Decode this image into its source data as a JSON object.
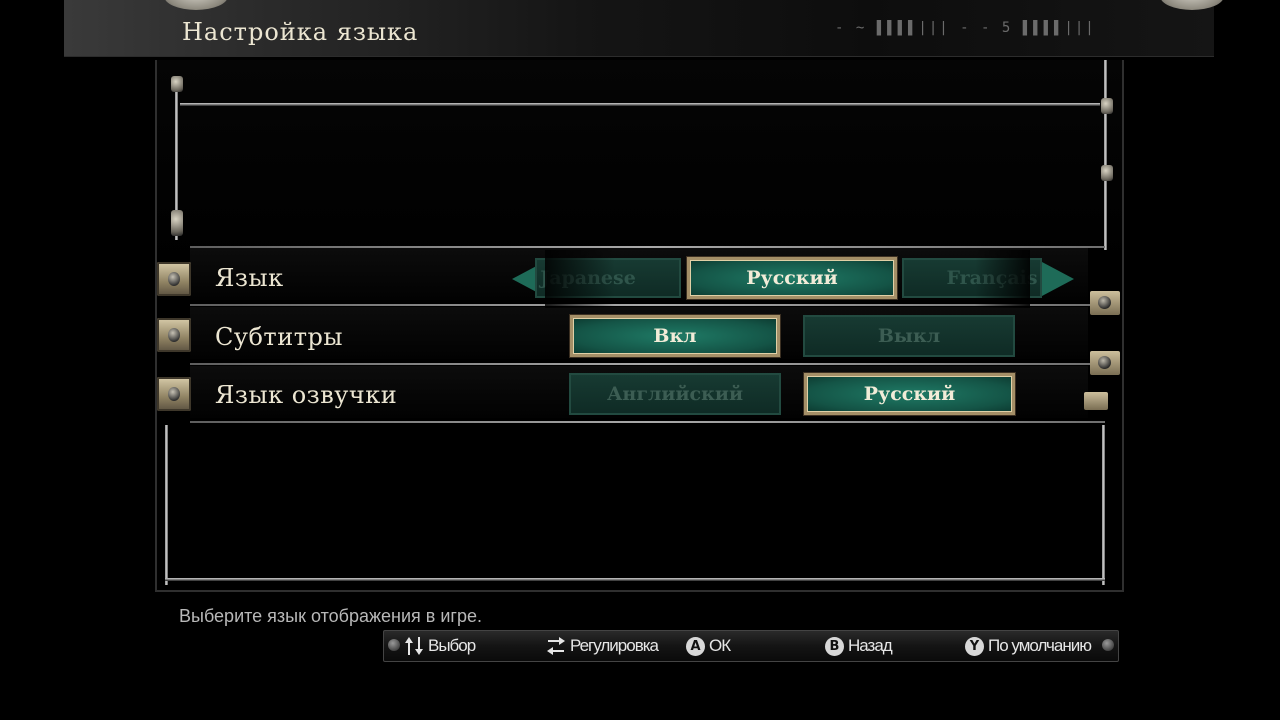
{
  "header": {
    "title": "Настройка языка",
    "glyph_strip": "-  ~  ▌▌▌▌|||  - -  5  ▌▌▌▌|||"
  },
  "rows": [
    {
      "label": "Язык",
      "left_arrow": "arrow-left-icon",
      "right_arrow": "arrow-right-icon",
      "options": [
        {
          "label": "Japanese",
          "selected": false
        },
        {
          "label": "Русский",
          "selected": true
        },
        {
          "label": "Français",
          "selected": false
        }
      ]
    },
    {
      "label": "Субтитры",
      "options": [
        {
          "label": "Вкл",
          "selected": true
        },
        {
          "label": "Выкл",
          "selected": false
        }
      ]
    },
    {
      "label": "Язык озвучки",
      "options": [
        {
          "label": "Английский",
          "selected": false
        },
        {
          "label": "Русский",
          "selected": true
        }
      ]
    }
  ],
  "help_text": "Выберите язык отображения в игре.",
  "controls": [
    {
      "icon": "dpad-updown-icon",
      "label": "Выбор"
    },
    {
      "icon": "swap-horizontal-icon",
      "label": "Регулировка"
    },
    {
      "icon": "A",
      "label": "ОК"
    },
    {
      "icon": "B",
      "label": "Назад"
    },
    {
      "icon": "Y",
      "label": "По умолчанию"
    }
  ],
  "colors": {
    "selected_fill": "#1f7b66",
    "unselected_fill": "#173a32",
    "selected_border": "#a48f67",
    "label_text": "#ece6d2"
  }
}
